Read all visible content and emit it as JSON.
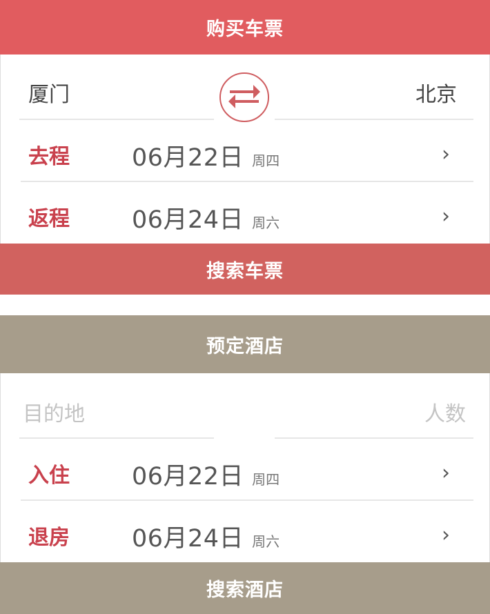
{
  "ticket": {
    "header": "购买车票",
    "from_city": "厦门",
    "to_city": "北京",
    "swap_icon": "swap-arrows-icon",
    "rows": [
      {
        "label": "去程",
        "date": "06月22日",
        "weekday": "周四",
        "chevron": "›"
      },
      {
        "label": "返程",
        "date": "06月24日",
        "weekday": "周六",
        "chevron": "›"
      }
    ],
    "search_label": "搜索车票"
  },
  "hotel": {
    "header": "预定酒店",
    "destination_placeholder": "目的地",
    "guests_placeholder": "人数",
    "rows": [
      {
        "label": "入住",
        "date": "06月22日",
        "weekday": "周四",
        "chevron": "›"
      },
      {
        "label": "退房",
        "date": "06月24日",
        "weekday": "周六",
        "chevron": "›"
      }
    ],
    "search_label": "搜索酒店"
  },
  "colors": {
    "ticket_accent": "#e15c5f",
    "ticket_button": "#d1625f",
    "hotel_accent": "#a79d8b",
    "label_red": "#c9414d"
  }
}
